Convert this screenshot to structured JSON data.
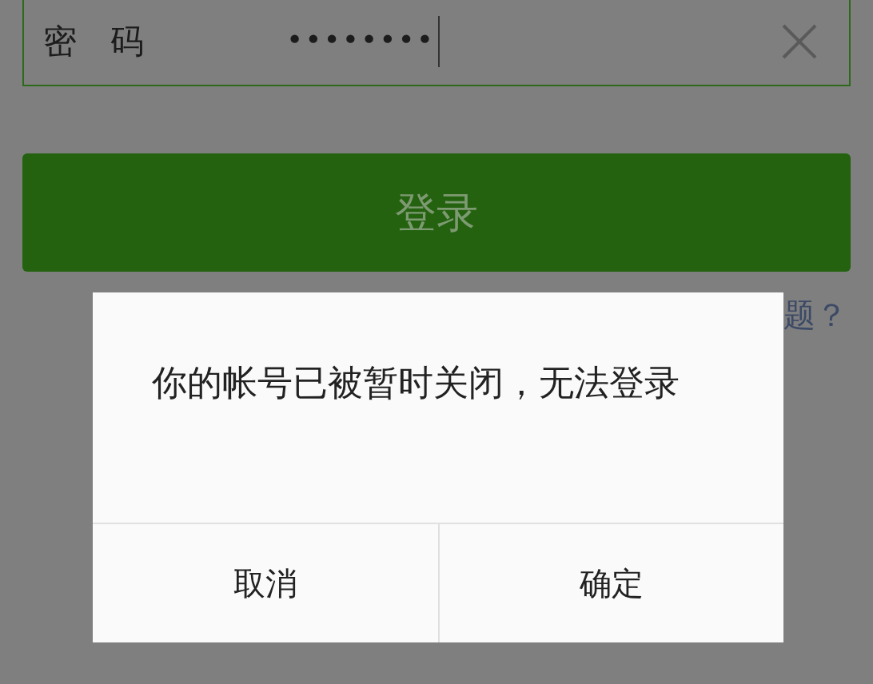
{
  "password_field": {
    "label": "密　码",
    "value": "••••••••",
    "focused": true
  },
  "login_button": {
    "label": "登录"
  },
  "help_link": {
    "text": "题？"
  },
  "dialog": {
    "message": "你的帐号已被暂时关闭，无法登录",
    "buttons": [
      "取消",
      "确定"
    ]
  }
}
